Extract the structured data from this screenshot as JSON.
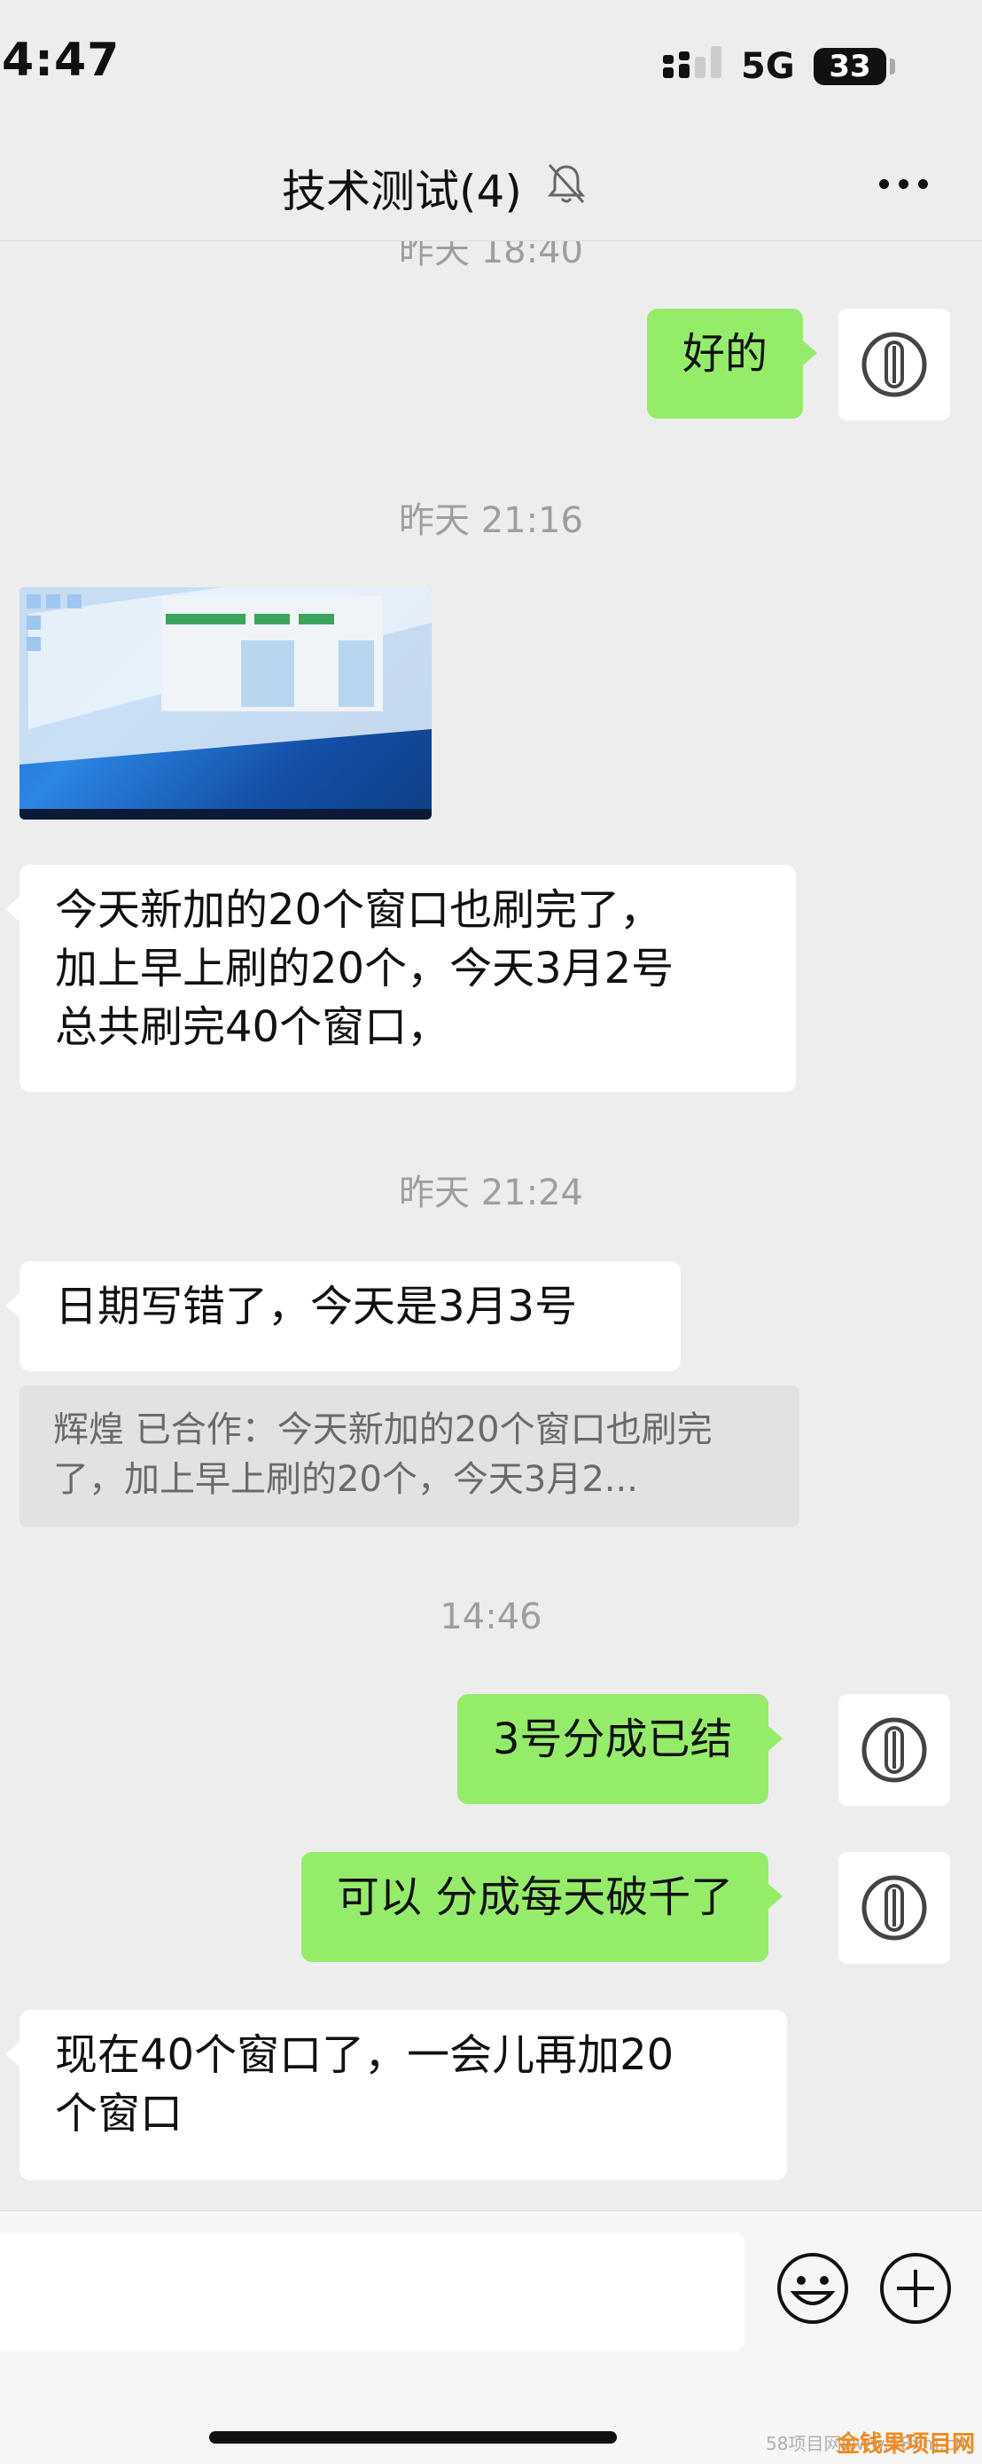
{
  "status": {
    "time": "4:47",
    "network": "5G",
    "battery": "33"
  },
  "header": {
    "title": "技术测试(4)"
  },
  "messages": {
    "ts0": "昨天 18:40",
    "m1": "好的",
    "ts1": "昨天 21:16",
    "m2": "今天新加的20个窗口也刷完了，\n加上早上刷的20个，今天3月2号\n总共刷完40个窗口，",
    "ts2": "昨天 21:24",
    "m3": "日期写错了，今天是3月3号",
    "quote": "辉煌 已合作：今天新加的20个窗口也刷完了，加上早上刷的20个，今天3月2...",
    "ts3": "14:46",
    "m4": "3号分成已结",
    "m5": "可以 分成每天破千了",
    "m6": "现在40个窗口了，一会儿再加20\n个窗口"
  },
  "watermark": {
    "text": "58项目网www.58xm.cn",
    "logo": "金钱果项目网"
  },
  "colors": {
    "background": "#ededed",
    "outgoing": "#95ec69",
    "incoming": "#ffffff",
    "timestamp": "#9e9e9e"
  }
}
